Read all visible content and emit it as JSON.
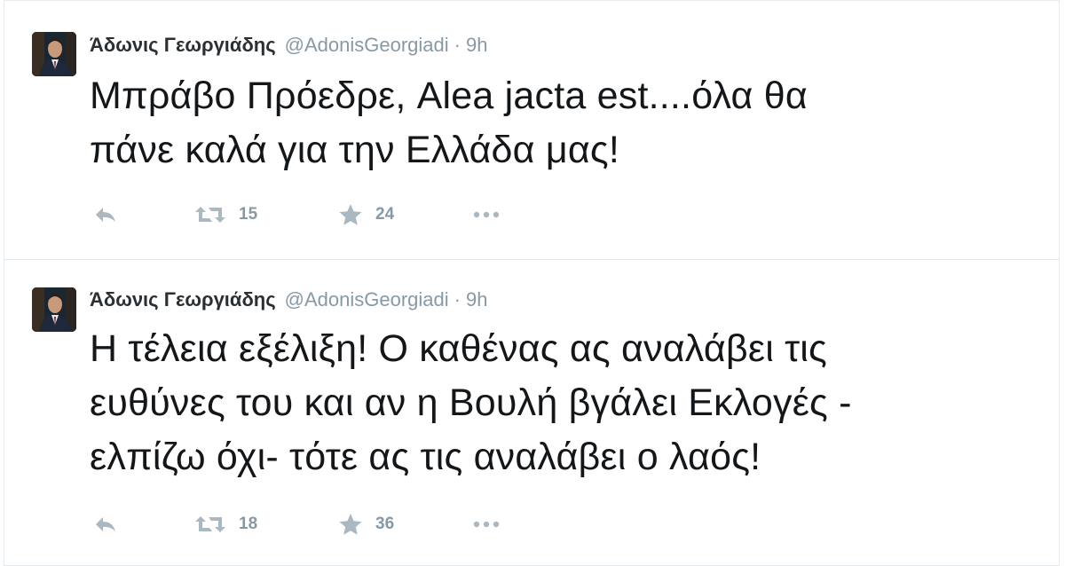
{
  "tweets": [
    {
      "author": {
        "fullname": "Άδωνις Γεωργιάδης",
        "username": "@AdonisGeorgiadi"
      },
      "separator": "·",
      "time": "9h",
      "text_lines": [
        "Μπράβο Πρόεδρε, Alea jacta est....όλα θα",
        "πάνε καλά για την Ελλάδα μας!"
      ],
      "actions": {
        "reply_icon": "reply-icon",
        "retweet_icon": "retweet-icon",
        "retweet_count": "15",
        "favorite_icon": "star-icon",
        "favorite_count": "24",
        "more_icon": "more-dots-icon"
      }
    },
    {
      "author": {
        "fullname": "Άδωνις Γεωργιάδης",
        "username": "@AdonisGeorgiadi"
      },
      "separator": "·",
      "time": "9h",
      "text_lines": [
        "Η τέλεια εξέλιξη! Ο καθένας ας αναλάβει τις",
        "ευθύνες του και αν η Βουλή βγάλει Εκλογές -",
        "ελπίζω όχι- τότε ας τις αναλάβει ο λαός!"
      ],
      "actions": {
        "reply_icon": "reply-icon",
        "retweet_icon": "retweet-icon",
        "retweet_count": "18",
        "favorite_icon": "star-icon",
        "favorite_count": "36",
        "more_icon": "more-dots-icon"
      }
    }
  ],
  "colors": {
    "text": "#14171a",
    "secondary": "#8899a6",
    "icon": "#aab8c2",
    "border": "#e1e8ed"
  }
}
